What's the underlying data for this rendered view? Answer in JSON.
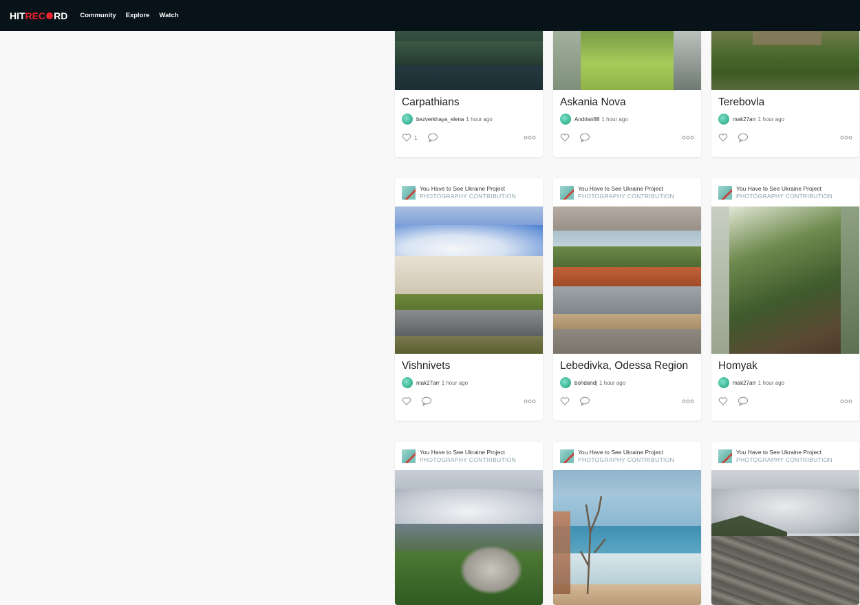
{
  "nav": {
    "logo": {
      "hit": "HIT",
      "rec": "REC",
      "rd": "RD"
    },
    "links": [
      "Community",
      "Explore",
      "Watch"
    ]
  },
  "cards_row1": [
    {
      "title": "Carpathians",
      "author": "bezverkhaya_elena",
      "ago": "1 hour ago",
      "likes": "1"
    },
    {
      "title": "Askania Nova",
      "author": "Andrian88",
      "ago": "1 hour ago",
      "likes": ""
    },
    {
      "title": "Terebovla",
      "author": "mak27arr",
      "ago": "1 hour ago",
      "likes": ""
    }
  ],
  "cards_row2": [
    {
      "project": "You Have to See Ukraine Project",
      "type": "PHOTOGRAPHY CONTRIBUTION",
      "title": "Vishnivets",
      "author": "mak27arr",
      "ago": "1 hour ago",
      "likes": ""
    },
    {
      "project": "You Have to See Ukraine Project",
      "type": "PHOTOGRAPHY CONTRIBUTION",
      "title": "Lebedivka, Odessa Region",
      "author": "bohdandj",
      "ago": "1 hour ago",
      "likes": ""
    },
    {
      "project": "You Have to See Ukraine Project",
      "type": "PHOTOGRAPHY CONTRIBUTION",
      "title": "Homyak",
      "author": "mak27arr",
      "ago": "1 hour ago",
      "likes": ""
    }
  ],
  "cards_row3": [
    {
      "project": "You Have to See Ukraine Project",
      "type": "PHOTOGRAPHY CONTRIBUTION"
    },
    {
      "project": "You Have to See Ukraine Project",
      "type": "PHOTOGRAPHY CONTRIBUTION"
    },
    {
      "project": "You Have to See Ukraine Project",
      "type": "PHOTOGRAPHY CONTRIBUTION"
    }
  ],
  "icons": {
    "heart": "heart-icon",
    "comment": "comment-icon",
    "more": "more-icon",
    "avatar": "avatar"
  },
  "colors": {
    "nav_bg": "#071219",
    "logo_red": "#e8242d",
    "contribution_text": "#8fa3ad"
  }
}
